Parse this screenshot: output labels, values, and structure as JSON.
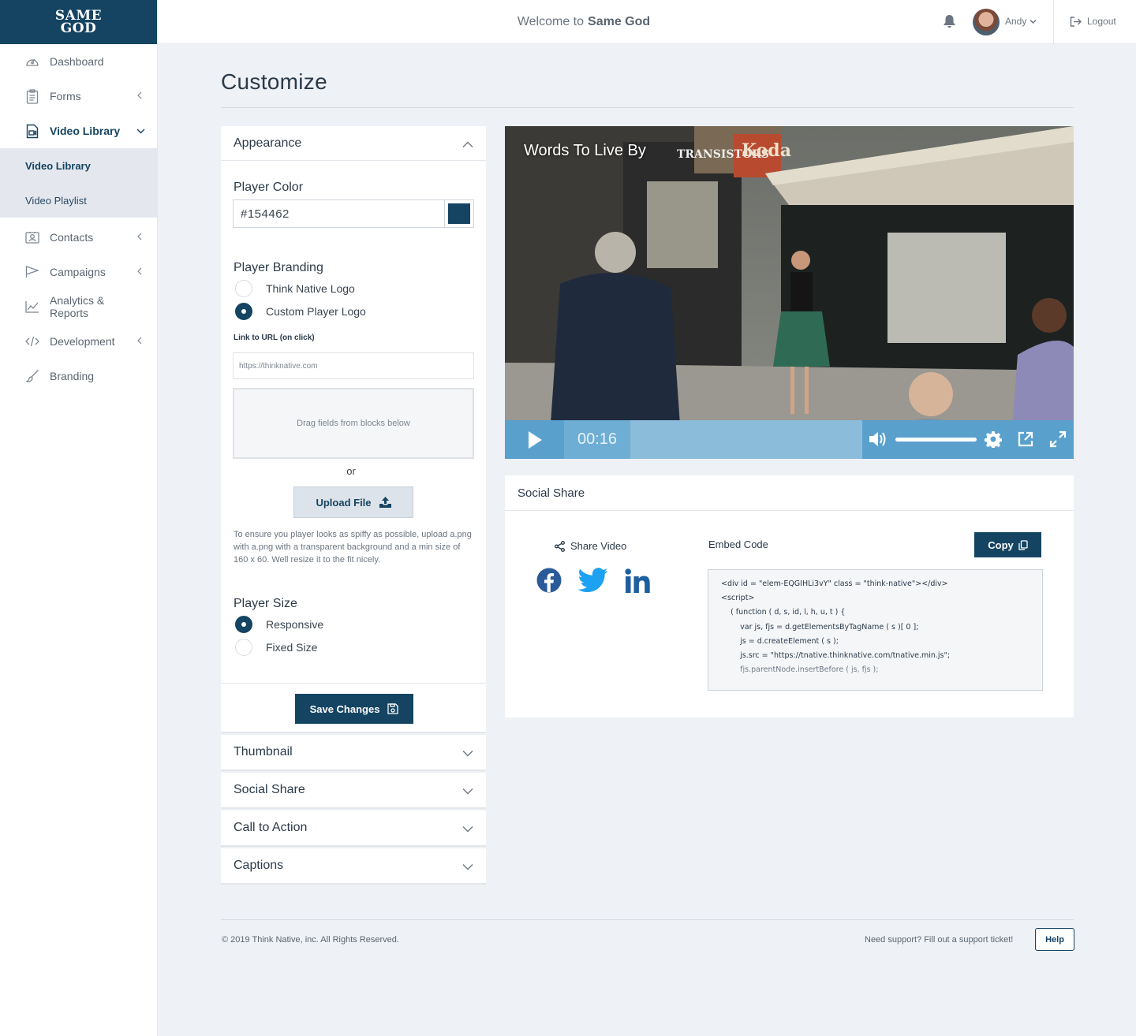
{
  "brand": {
    "line1": "SAME",
    "line2": "GOD",
    "color": "#154462"
  },
  "sidebar": {
    "items": [
      {
        "label": "Dashboard",
        "icon": "dashboard-gauge-icon"
      },
      {
        "label": "Forms",
        "icon": "clipboard-icon"
      },
      {
        "label": "Video Library",
        "icon": "video-file-icon"
      },
      {
        "label": "Contacts",
        "icon": "contact-card-icon"
      },
      {
        "label": "Campaigns",
        "icon": "flag-icon"
      },
      {
        "label": "Analytics & Reports",
        "icon": "line-chart-icon"
      },
      {
        "label": "Development",
        "icon": "code-icon"
      },
      {
        "label": "Branding",
        "icon": "brush-icon"
      }
    ],
    "subitems": [
      {
        "label": "Video Library"
      },
      {
        "label": "Video Playlist"
      }
    ]
  },
  "header": {
    "welcome_prefix": "Welcome to",
    "welcome_name": "Same God",
    "user": "Andy",
    "logout": "Logout"
  },
  "page": {
    "title": "Customize"
  },
  "appearance": {
    "title": "Appearance",
    "player_color_label": "Player Color",
    "player_color_value": "#154462",
    "branding_label": "Player Branding",
    "branding_options": [
      "Think Native Logo",
      "Custom Player Logo"
    ],
    "branding_selected": "Custom Player Logo",
    "link_label": "Link to URL (on click)",
    "link_placeholder": "https://thinknative.com",
    "dropzone_text": "Drag fields from blocks below",
    "or_text": "or",
    "upload_label": "Upload File",
    "hint": "To ensure you player looks as spiffy as possible, upload a.png with a.png with a transparent background and a min size of 160 x 60. Well resize it to the fit nicely.",
    "size_label": "Player Size",
    "size_options": [
      "Responsive",
      "Fixed Size"
    ],
    "size_selected": "Responsive",
    "save_label": "Save Changes"
  },
  "collapsed_panels": [
    "Thumbnail",
    "Social Share",
    "Call to Action",
    "Captions"
  ],
  "video": {
    "title": "Words To Live By",
    "time": "00:16",
    "volume_level": 1.0,
    "control_color": "#5aa0cd"
  },
  "social_share": {
    "title": "Social Share",
    "share_video_label": "Share Video",
    "networks": [
      "facebook",
      "twitter",
      "linkedin"
    ],
    "embed_label": "Embed Code",
    "copy_label": "Copy",
    "embed_code": [
      "<div id = \"elem-EQGIHLi3vY\" class = \"think-native\"></div>",
      "<script>",
      "    ( function ( d, s, id, l, h, u, t ) {",
      "        var js, fjs = d.getElementsByTagName ( s )[ 0 ];",
      "        js = d.createElement ( s );",
      "        js.src = \"https://tnative.thinknative.com/tnative.min.js\";",
      "        fjs.parentNode.insertBefore ( js, fjs );"
    ]
  },
  "footer": {
    "copyright": "© 2019 Think Native, inc. All Rights Reserved.",
    "support": "Need support? Fill out a support ticket!",
    "help": "Help"
  }
}
